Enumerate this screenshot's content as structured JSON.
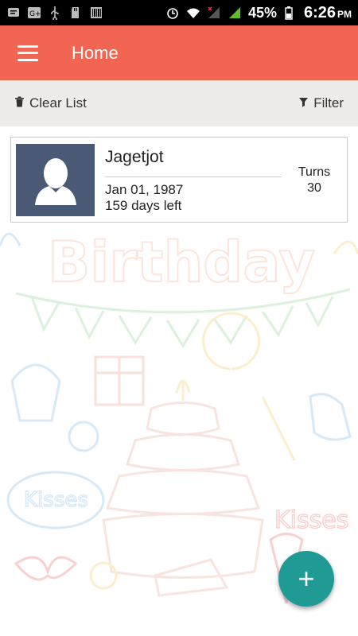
{
  "colors": {
    "app_bar": "#f26552",
    "toolbar_bg": "#eeebea",
    "fab": "#1f9a95",
    "avatar_bg": "#4a5a74"
  },
  "status_bar": {
    "left_icons": [
      "message-icon",
      "google-plus-icon",
      "usb-icon",
      "sd-card-icon",
      "barcode-icon"
    ],
    "right_icons": [
      "alarm-icon",
      "wifi-icon",
      "no-signal-icon",
      "signal-icon",
      "battery-icon"
    ],
    "battery": "45%",
    "time": "6:26",
    "ampm": "PM"
  },
  "app_bar": {
    "title": "Home",
    "menu_icon": "hamburger-menu-icon"
  },
  "toolbar": {
    "clear_label": "Clear List",
    "clear_icon": "trash-icon",
    "filter_label": "Filter",
    "filter_icon": "filter-icon"
  },
  "list": [
    {
      "name": "Jagetjot",
      "date": "Jan 01, 1987",
      "days_left": "159 days left",
      "turns_label": "Turns",
      "turns_value": "30",
      "avatar_icon": "person-placeholder-icon"
    }
  ],
  "fab": {
    "label": "+",
    "icon": "plus-icon"
  }
}
